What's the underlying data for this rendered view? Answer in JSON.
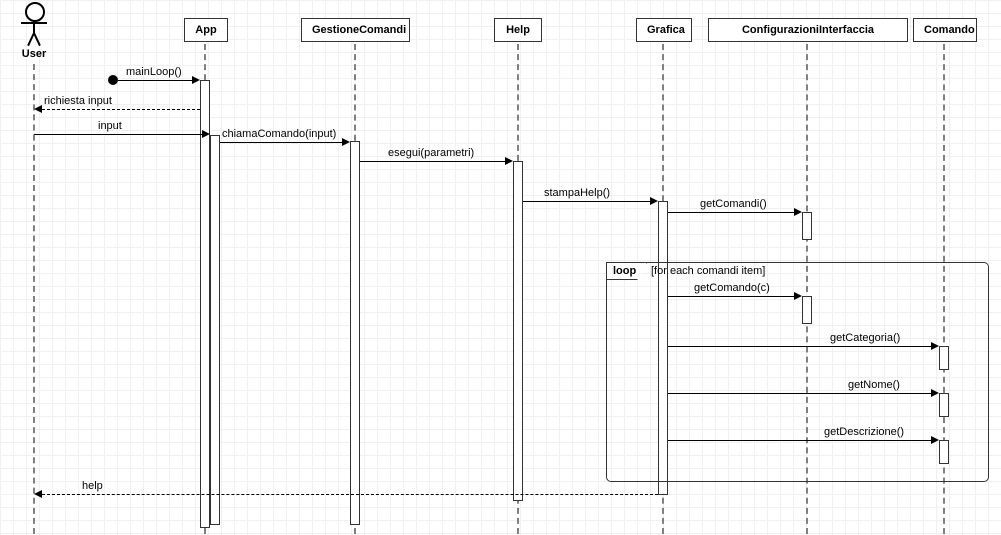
{
  "diagram_type": "sequence-diagram",
  "actor": {
    "name": "User"
  },
  "lifelines": {
    "app": "App",
    "gestione": "GestioneComandi",
    "help": "Help",
    "grafica": "Grafica",
    "config": "ConfigurazioniInterfaccia",
    "comando": "Comando"
  },
  "fragment": {
    "operator": "loop",
    "guard": "[for each comandi item]"
  },
  "messages": {
    "m1": "mainLoop()",
    "m2": "richiesta input",
    "m3": "input",
    "m4": "chiamaComando(input)",
    "m5": "esegui(parametri)",
    "m6": "stampaHelp()",
    "m7": "getComandi()",
    "m8": "getComando(c)",
    "m9": "getCategoria()",
    "m10": "getNome()",
    "m11": "getDescrizione()",
    "m12": "help"
  }
}
